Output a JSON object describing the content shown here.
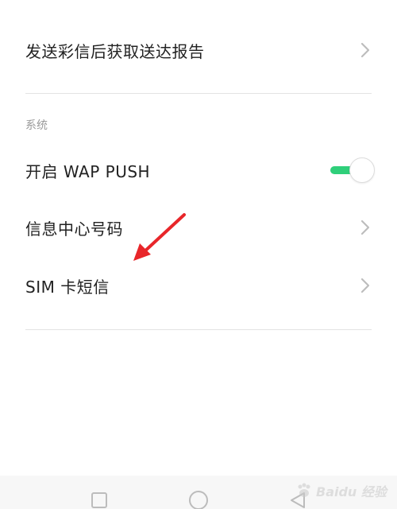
{
  "settings": {
    "rows": [
      {
        "label": "发送彩信后获取送达报告",
        "type": "chevron"
      },
      {
        "label": "开启 WAP PUSH",
        "type": "toggle",
        "toggle_on": true
      },
      {
        "label": "信息中心号码",
        "type": "chevron"
      },
      {
        "label": "SIM 卡短信",
        "type": "chevron"
      }
    ],
    "section_header": "系统"
  },
  "colors": {
    "toggle_on": "#2fcf7a",
    "chevron": "#bdbdbd",
    "annotation_arrow": "#e8262a",
    "nav_icons": "#bcbcbc"
  },
  "icons": {
    "chevron": "chevron-right-icon",
    "nav_recents": "square-icon",
    "nav_home": "circle-icon",
    "nav_back": "triangle-back-icon",
    "annotation": "red-arrow-icon"
  },
  "watermark": {
    "text": "Baidu 经验"
  }
}
